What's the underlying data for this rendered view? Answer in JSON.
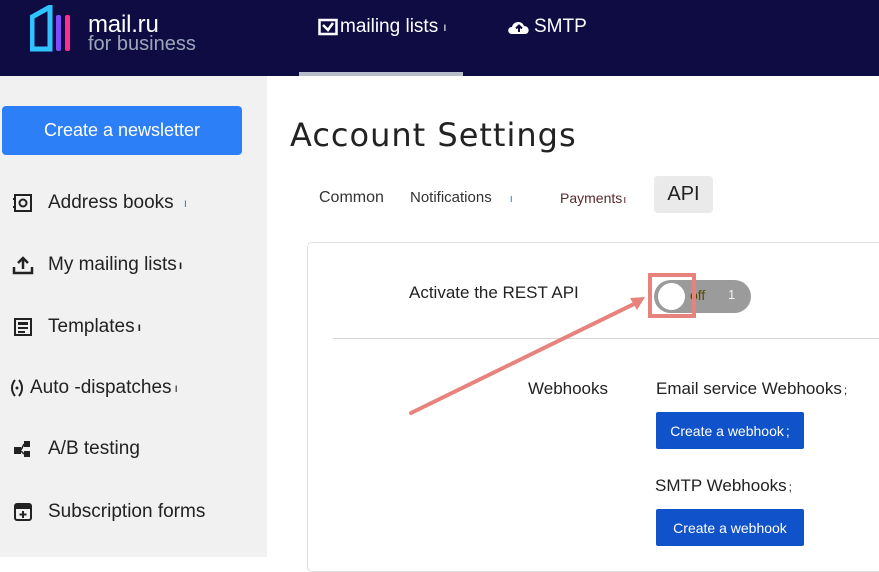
{
  "header": {
    "logo_main": "mail.ru",
    "logo_sub": "for business",
    "nav": [
      {
        "label": "mailing lists",
        "icon": "checkbox-mail-icon"
      },
      {
        "label": "SMTP",
        "icon": "cloud-upload-icon"
      }
    ]
  },
  "sidebar": {
    "create_label": "Create a newsletter",
    "items": [
      {
        "label": "Address books",
        "icon": "address-book-icon"
      },
      {
        "label": "My mailing lists",
        "icon": "upload-tray-icon"
      },
      {
        "label": "Templates",
        "icon": "template-icon"
      },
      {
        "label": "Auto -dispatches",
        "icon": "auto-dispatch-icon"
      },
      {
        "label": "A/B testing",
        "icon": "ab-testing-icon"
      },
      {
        "label": "Subscription forms",
        "icon": "form-icon"
      }
    ]
  },
  "main": {
    "title": "Account Settings",
    "tabs": [
      {
        "label": "Common"
      },
      {
        "label": "Notifications"
      },
      {
        "label": "Payments"
      },
      {
        "label": "API"
      }
    ],
    "rest_api": {
      "label": "Activate the REST API",
      "toggle_state": "off",
      "toggle_count": "1"
    },
    "webhooks": {
      "section_label": "Webhooks",
      "email_label": "Email service Webhooks",
      "email_button": "Create a webhook",
      "smtp_label": "SMTP Webhooks",
      "smtp_button": "Create a webhook"
    }
  },
  "colors": {
    "topbar": "#0f0c44",
    "primary_button": "#2c7ff6",
    "webhook_button": "#1052c9",
    "highlight": "#e8827c"
  }
}
